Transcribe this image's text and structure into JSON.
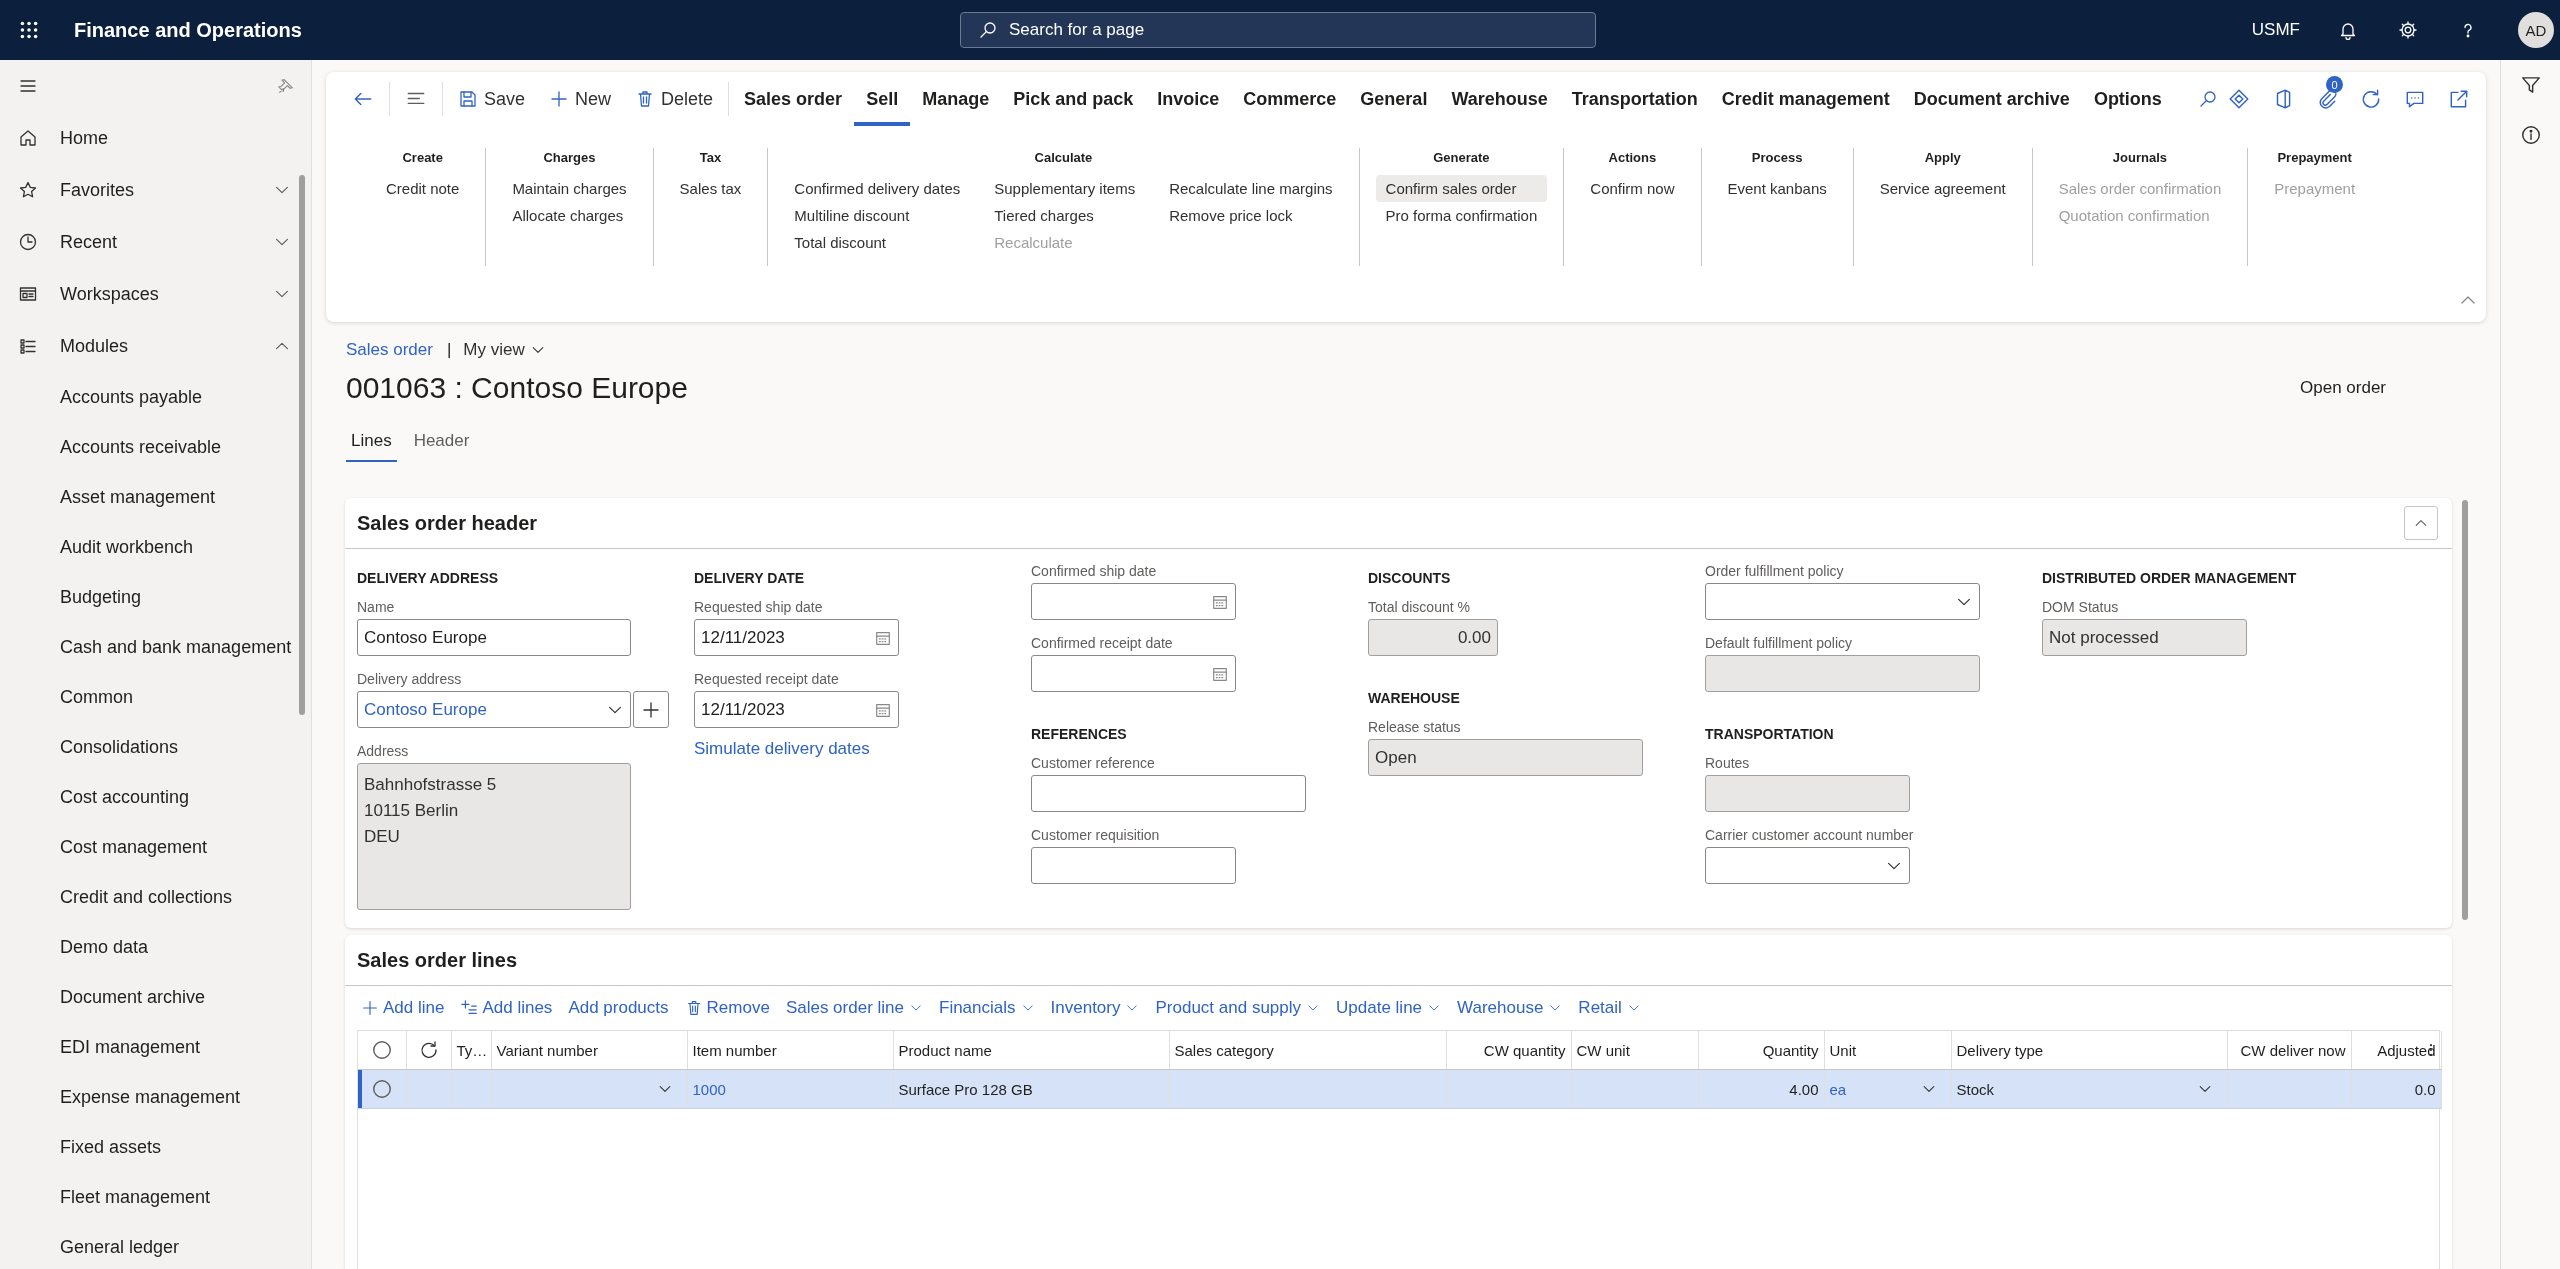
{
  "app_bar": {
    "title": "Finance and Operations",
    "search": {
      "placeholder": "Search for a page"
    },
    "company": "USMF",
    "avatar": "AD"
  },
  "navigation": {
    "items": [
      {
        "label": "Home",
        "kind": "link"
      },
      {
        "label": "Favorites",
        "kind": "group",
        "expanded": false
      },
      {
        "label": "Recent",
        "kind": "group",
        "expanded": false
      },
      {
        "label": "Workspaces",
        "kind": "group",
        "expanded": false
      },
      {
        "label": "Modules",
        "kind": "group",
        "expanded": true,
        "children": [
          {
            "label": "Accounts payable"
          },
          {
            "label": "Accounts receivable"
          },
          {
            "label": "Asset management"
          },
          {
            "label": "Audit workbench"
          },
          {
            "label": "Budgeting"
          },
          {
            "label": "Cash and bank management"
          },
          {
            "label": "Common"
          },
          {
            "label": "Consolidations"
          },
          {
            "label": "Cost accounting"
          },
          {
            "label": "Cost management"
          },
          {
            "label": "Credit and collections"
          },
          {
            "label": "Demo data"
          },
          {
            "label": "Document archive"
          },
          {
            "label": "EDI management"
          },
          {
            "label": "Expense management"
          },
          {
            "label": "Fixed assets"
          },
          {
            "label": "Fleet management"
          },
          {
            "label": "General ledger"
          }
        ]
      }
    ]
  },
  "action_pane": {
    "buttons": [
      {
        "label": "Save"
      },
      {
        "label": "New"
      },
      {
        "label": "Delete"
      }
    ],
    "tabs": [
      {
        "label": "Sales order",
        "selected": false
      },
      {
        "label": "Sell",
        "selected": true
      },
      {
        "label": "Manage",
        "selected": false
      },
      {
        "label": "Pick and pack",
        "selected": false
      },
      {
        "label": "Invoice",
        "selected": false
      },
      {
        "label": "Commerce",
        "selected": false
      },
      {
        "label": "General",
        "selected": false
      },
      {
        "label": "Warehouse",
        "selected": false
      },
      {
        "label": "Transportation",
        "selected": false
      },
      {
        "label": "Credit management",
        "selected": false
      },
      {
        "label": "Document archive",
        "selected": false
      },
      {
        "label": "Options",
        "selected": false
      }
    ],
    "attachments_count": "0",
    "groups": [
      {
        "title": "Create",
        "columns": [
          [
            {
              "label": "Credit note",
              "disabled": false,
              "highlighted": false
            }
          ]
        ]
      },
      {
        "title": "Charges",
        "columns": [
          [
            {
              "label": "Maintain charges",
              "disabled": false,
              "highlighted": false
            },
            {
              "label": "Allocate charges",
              "disabled": false,
              "highlighted": false
            }
          ]
        ]
      },
      {
        "title": "Tax",
        "columns": [
          [
            {
              "label": "Sales tax",
              "disabled": false,
              "highlighted": false
            }
          ]
        ]
      },
      {
        "title": "Calculate",
        "columns": [
          [
            {
              "label": "Confirmed delivery dates",
              "disabled": false,
              "highlighted": false
            },
            {
              "label": "Multiline discount",
              "disabled": false,
              "highlighted": false
            },
            {
              "label": "Total discount",
              "disabled": false,
              "highlighted": false
            }
          ],
          [
            {
              "label": "Supplementary items",
              "disabled": false,
              "highlighted": false
            },
            {
              "label": "Tiered charges",
              "disabled": false,
              "highlighted": false
            },
            {
              "label": "Recalculate",
              "disabled": true,
              "highlighted": false
            }
          ],
          [
            {
              "label": "Recalculate line margins",
              "disabled": false,
              "highlighted": false
            },
            {
              "label": "Remove price lock",
              "disabled": false,
              "highlighted": false
            }
          ]
        ]
      },
      {
        "title": "Generate",
        "columns": [
          [
            {
              "label": "Confirm sales order",
              "disabled": false,
              "highlighted": true
            },
            {
              "label": "Pro forma confirmation",
              "disabled": false,
              "highlighted": false
            }
          ]
        ]
      },
      {
        "title": "Actions",
        "columns": [
          [
            {
              "label": "Confirm now",
              "disabled": false,
              "highlighted": false
            }
          ]
        ]
      },
      {
        "title": "Process",
        "columns": [
          [
            {
              "label": "Event kanbans",
              "disabled": false,
              "highlighted": false
            }
          ]
        ]
      },
      {
        "title": "Apply",
        "columns": [
          [
            {
              "label": "Service agreement",
              "disabled": false,
              "highlighted": false
            }
          ]
        ]
      },
      {
        "title": "Journals",
        "columns": [
          [
            {
              "label": "Sales order confirmation",
              "disabled": true,
              "highlighted": false
            },
            {
              "label": "Quotation confirmation",
              "disabled": true,
              "highlighted": false
            }
          ]
        ]
      },
      {
        "title": "Prepayment",
        "columns": [
          [
            {
              "label": "Prepayment",
              "disabled": true,
              "highlighted": false
            }
          ]
        ]
      }
    ]
  },
  "page": {
    "breadcrumb": "Sales order",
    "separator": "|",
    "view": "My view",
    "title": "001063 : Contoso Europe",
    "status": "Open order",
    "tabs": [
      {
        "label": "Lines",
        "selected": true
      },
      {
        "label": "Header",
        "selected": false
      }
    ]
  },
  "header_section": {
    "title": "Sales order header",
    "expanded": true,
    "columns": [
      [
        {
          "kind": "heading",
          "text": "DELIVERY ADDRESS"
        },
        {
          "kind": "text",
          "label": "Name",
          "value": "Contoso Europe",
          "readonly": false
        },
        {
          "kind": "combo",
          "label": "Delivery address",
          "value": "Contoso Europe",
          "link": true,
          "add_button": true,
          "readonly": false
        },
        {
          "kind": "address",
          "label": "Address",
          "lines": [
            "Bahnhofstrasse 5",
            "10115 Berlin",
            "DEU"
          ],
          "readonly": true
        }
      ],
      [
        {
          "kind": "heading",
          "text": "DELIVERY DATE"
        },
        {
          "kind": "date",
          "label": "Requested ship date",
          "value": "12/11/2023",
          "readonly": false
        },
        {
          "kind": "date",
          "label": "Requested receipt date",
          "value": "12/11/2023",
          "readonly": false
        },
        {
          "kind": "link",
          "text": "Simulate delivery dates"
        }
      ],
      [
        {
          "kind": "date",
          "label": "Confirmed ship date",
          "readonly": false
        },
        {
          "kind": "date",
          "label": "Confirmed receipt date",
          "readonly": false
        },
        {
          "kind": "heading",
          "text": "REFERENCES"
        },
        {
          "kind": "text",
          "label": "Customer reference",
          "readonly": false
        },
        {
          "kind": "text",
          "label": "Customer requisition",
          "readonly": false
        }
      ],
      [
        {
          "kind": "heading",
          "text": "DISCOUNTS"
        },
        {
          "kind": "number",
          "label": "Total discount %",
          "value": "0.00",
          "readonly": true
        },
        {
          "kind": "heading",
          "text": "WAREHOUSE"
        },
        {
          "kind": "text",
          "label": "Release status",
          "value": "Open",
          "readonly": true
        }
      ],
      [
        {
          "kind": "combo",
          "label": "Order fulfillment policy",
          "readonly": false
        },
        {
          "kind": "text",
          "label": "Default fulfillment policy",
          "readonly": true
        },
        {
          "kind": "heading",
          "text": "TRANSPORTATION"
        },
        {
          "kind": "text",
          "label": "Routes",
          "readonly": true
        },
        {
          "kind": "combo",
          "label": "Carrier customer account number",
          "readonly": false
        }
      ],
      [
        {
          "kind": "heading",
          "text": "DISTRIBUTED ORDER MANAGEMENT"
        },
        {
          "kind": "text",
          "label": "DOM Status",
          "value": "Not processed",
          "readonly": true
        }
      ]
    ]
  },
  "lines_section": {
    "title": "Sales order lines",
    "toolbar": [
      {
        "label": "Add line",
        "dropdown": false
      },
      {
        "label": "Add lines",
        "dropdown": false
      },
      {
        "label": "Add products",
        "dropdown": false
      },
      {
        "label": "Remove",
        "dropdown": false
      },
      {
        "label": "Sales order line",
        "dropdown": true
      },
      {
        "label": "Financials",
        "dropdown": true
      },
      {
        "label": "Inventory",
        "dropdown": true
      },
      {
        "label": "Product and supply",
        "dropdown": true
      },
      {
        "label": "Update line",
        "dropdown": true
      },
      {
        "label": "Warehouse",
        "dropdown": true
      },
      {
        "label": "Retail",
        "dropdown": true
      }
    ],
    "table": {
      "all_selected": false,
      "columns": [
        {
          "kind": "select"
        },
        {
          "kind": "refresh"
        },
        {
          "label": "Ty…",
          "kind": "text"
        },
        {
          "label": "Variant number",
          "kind": "combo"
        },
        {
          "label": "Item number",
          "kind": "link"
        },
        {
          "label": "Product name",
          "kind": "text"
        },
        {
          "label": "Sales category",
          "kind": "text"
        },
        {
          "label": "CW quantity",
          "kind": "number"
        },
        {
          "label": "CW unit",
          "kind": "text"
        },
        {
          "label": "Quantity",
          "kind": "number"
        },
        {
          "label": "Unit",
          "kind": "link-combo"
        },
        {
          "label": "Delivery type",
          "kind": "combo"
        },
        {
          "label": "CW deliver now",
          "kind": "number"
        },
        {
          "label": "Adjusted",
          "kind": "number"
        }
      ],
      "rows": [
        {
          "selected": true,
          "item_number": "1000",
          "product_name": "Surface Pro 128 GB",
          "quantity": "4.00",
          "unit": "ea",
          "delivery_type": "Stock",
          "adjusted": "0.0"
        }
      ]
    }
  }
}
